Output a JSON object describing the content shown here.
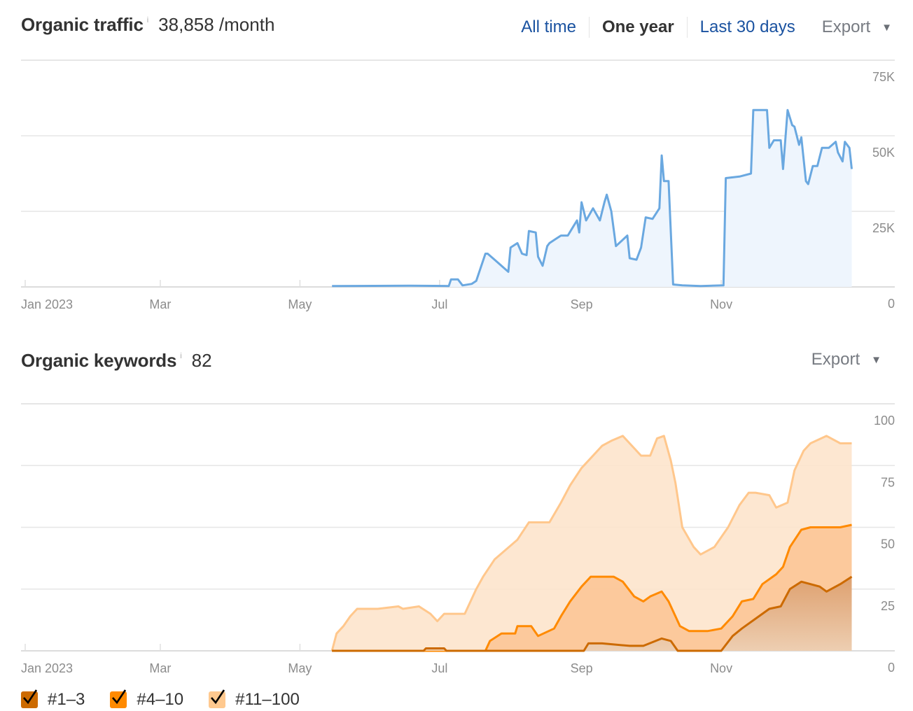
{
  "traffic": {
    "title": "Organic traffic",
    "info_icon": "i",
    "value": "38,858 /month",
    "ranges": [
      "All time",
      "One year",
      "Last 30 days"
    ],
    "active_range": "One year",
    "export_label": "Export"
  },
  "keywords": {
    "title": "Organic keywords",
    "info_icon": "i",
    "value": "82",
    "export_label": "Export",
    "legend": [
      {
        "label": "#1–3",
        "color": "#cc6a00",
        "checked": true
      },
      {
        "label": "#4–10",
        "color": "#ff8a00",
        "checked": true
      },
      {
        "label": "#11–100",
        "color": "#ffc98f",
        "checked": true
      }
    ]
  },
  "colors": {
    "traffic_line": "#6aa8e0",
    "traffic_fill": "#eef5fd",
    "kw_top3_line": "#cc6a00",
    "kw_top10_line": "#ff8a00",
    "kw_top100_line": "#ffc78c",
    "grid": "#e6e6e6",
    "link": "#1a52a0"
  },
  "chart_data": [
    {
      "type": "area",
      "title": "Organic traffic",
      "x_unit": "day of year 2023",
      "xlim": [
        0,
        365
      ],
      "x_ticks": [
        {
          "day": 0,
          "label": "Jan 2023"
        },
        {
          "day": 59,
          "label": "Mar"
        },
        {
          "day": 120,
          "label": "May"
        },
        {
          "day": 181,
          "label": "Jul"
        },
        {
          "day": 243,
          "label": "Sep"
        },
        {
          "day": 304,
          "label": "Nov"
        }
      ],
      "y_ticks": [
        {
          "value": 0,
          "label": "0"
        },
        {
          "value": 25000,
          "label": "25K"
        },
        {
          "value": 50000,
          "label": "50K"
        },
        {
          "value": 75000,
          "label": "75K"
        }
      ],
      "ylim": [
        0,
        75000
      ],
      "grid": true,
      "series": [
        {
          "name": "Organic traffic",
          "points": [
            [
              134,
              300
            ],
            [
              168,
              400
            ],
            [
              185,
              300
            ],
            [
              186,
              2500
            ],
            [
              189,
              2500
            ],
            [
              191,
              500
            ],
            [
              195,
              1000
            ],
            [
              197,
              2000
            ],
            [
              201,
              11000
            ],
            [
              202,
              11000
            ],
            [
              205,
              9000
            ],
            [
              208,
              7000
            ],
            [
              211,
              5000
            ],
            [
              212,
              13000
            ],
            [
              215,
              14500
            ],
            [
              217,
              11000
            ],
            [
              219,
              10500
            ],
            [
              220,
              18500
            ],
            [
              223,
              18000
            ],
            [
              224,
              10000
            ],
            [
              226,
              7000
            ],
            [
              228,
              13500
            ],
            [
              229,
              14500
            ],
            [
              232,
              16000
            ],
            [
              234,
              17000
            ],
            [
              237,
              17000
            ],
            [
              239,
              19500
            ],
            [
              241,
              22000
            ],
            [
              242,
              18000
            ],
            [
              243,
              28000
            ],
            [
              245,
              22000
            ],
            [
              248,
              26000
            ],
            [
              251,
              22000
            ],
            [
              253,
              28000
            ],
            [
              254,
              30500
            ],
            [
              256,
              25000
            ],
            [
              258,
              13500
            ],
            [
              263,
              17000
            ],
            [
              264,
              9500
            ],
            [
              267,
              9000
            ],
            [
              269,
              13000
            ],
            [
              271,
              23000
            ],
            [
              274,
              22500
            ],
            [
              277,
              26000
            ],
            [
              278,
              43500
            ],
            [
              279,
              35000
            ],
            [
              281,
              35000
            ],
            [
              283,
              800
            ],
            [
              287,
              500
            ],
            [
              295,
              300
            ],
            [
              305,
              500
            ],
            [
              306,
              36000
            ],
            [
              312,
              36500
            ],
            [
              317,
              37500
            ],
            [
              318,
              58500
            ],
            [
              324,
              58500
            ],
            [
              325,
              46000
            ],
            [
              327,
              48500
            ],
            [
              330,
              48500
            ],
            [
              331,
              39000
            ],
            [
              333,
              58500
            ],
            [
              335,
              53500
            ],
            [
              336,
              53000
            ],
            [
              338,
              47000
            ],
            [
              339,
              49500
            ],
            [
              341,
              35000
            ],
            [
              342,
              34000
            ],
            [
              344,
              40000
            ],
            [
              346,
              40000
            ],
            [
              348,
              46000
            ],
            [
              351,
              46000
            ],
            [
              354,
              48000
            ],
            [
              355,
              44500
            ],
            [
              357,
              41500
            ],
            [
              358,
              48000
            ],
            [
              360,
              46000
            ],
            [
              361,
              39000
            ]
          ]
        }
      ]
    },
    {
      "type": "area",
      "title": "Organic keywords",
      "x_unit": "day of year 2023",
      "xlim": [
        0,
        365
      ],
      "x_ticks": [
        {
          "day": 0,
          "label": "Jan 2023"
        },
        {
          "day": 59,
          "label": "Mar"
        },
        {
          "day": 120,
          "label": "May"
        },
        {
          "day": 181,
          "label": "Jul"
        },
        {
          "day": 243,
          "label": "Sep"
        },
        {
          "day": 304,
          "label": "Nov"
        }
      ],
      "y_ticks": [
        {
          "value": 0,
          "label": "0"
        },
        {
          "value": 25,
          "label": "25"
        },
        {
          "value": 50,
          "label": "50"
        },
        {
          "value": 75,
          "label": "75"
        },
        {
          "value": 100,
          "label": "100"
        }
      ],
      "ylim": [
        0,
        100
      ],
      "grid": true,
      "legend_position": "bottom-left",
      "series": [
        {
          "name": "#11–100",
          "points": [
            [
              134,
              0
            ],
            [
              136,
              7
            ],
            [
              139,
              10
            ],
            [
              142,
              14
            ],
            [
              145,
              17
            ],
            [
              154,
              17
            ],
            [
              163,
              18
            ],
            [
              165,
              17
            ],
            [
              172,
              18
            ],
            [
              177,
              15
            ],
            [
              180,
              12
            ],
            [
              183,
              15
            ],
            [
              192,
              15
            ],
            [
              197,
              25
            ],
            [
              200,
              30
            ],
            [
              205,
              37
            ],
            [
              215,
              45
            ],
            [
              220,
              52
            ],
            [
              229,
              52
            ],
            [
              234,
              60
            ],
            [
              238,
              67
            ],
            [
              243,
              74
            ],
            [
              247,
              78
            ],
            [
              252,
              83
            ],
            [
              256,
              85
            ],
            [
              261,
              87
            ],
            [
              264,
              84
            ],
            [
              269,
              79
            ],
            [
              273,
              79
            ],
            [
              276,
              86
            ],
            [
              279,
              87
            ],
            [
              282,
              77
            ],
            [
              284,
              68
            ],
            [
              287,
              50
            ],
            [
              292,
              42
            ],
            [
              295,
              39
            ],
            [
              301,
              42
            ],
            [
              307,
              50
            ],
            [
              312,
              59
            ],
            [
              316,
              64
            ],
            [
              319,
              64
            ],
            [
              325,
              63
            ],
            [
              328,
              58
            ],
            [
              333,
              60
            ],
            [
              336,
              73
            ],
            [
              340,
              81
            ],
            [
              343,
              84
            ],
            [
              350,
              87
            ],
            [
              356,
              84
            ],
            [
              361,
              84
            ]
          ]
        },
        {
          "name": "#4–10",
          "points": [
            [
              134,
              0
            ],
            [
              201,
              0
            ],
            [
              203,
              4
            ],
            [
              208,
              7
            ],
            [
              214,
              7
            ],
            [
              215,
              10
            ],
            [
              221,
              10
            ],
            [
              224,
              6
            ],
            [
              231,
              9
            ],
            [
              234,
              14
            ],
            [
              238,
              20
            ],
            [
              243,
              26
            ],
            [
              247,
              30
            ],
            [
              252,
              30
            ],
            [
              257,
              30
            ],
            [
              261,
              28
            ],
            [
              266,
              22
            ],
            [
              270,
              20
            ],
            [
              273,
              22
            ],
            [
              278,
              24
            ],
            [
              281,
              20
            ],
            [
              286,
              10
            ],
            [
              290,
              8
            ],
            [
              298,
              8
            ],
            [
              304,
              9
            ],
            [
              309,
              14
            ],
            [
              313,
              20
            ],
            [
              318,
              21
            ],
            [
              322,
              27
            ],
            [
              328,
              31
            ],
            [
              331,
              34
            ],
            [
              334,
              42
            ],
            [
              339,
              49
            ],
            [
              343,
              50
            ],
            [
              350,
              50
            ],
            [
              356,
              50
            ],
            [
              361,
              51
            ]
          ]
        },
        {
          "name": "#1–3",
          "points": [
            [
              134,
              0
            ],
            [
              174,
              0
            ],
            [
              175,
              1
            ],
            [
              183,
              1
            ],
            [
              184,
              0
            ],
            [
              244,
              0
            ],
            [
              246,
              3
            ],
            [
              252,
              3
            ],
            [
              264,
              2
            ],
            [
              270,
              2
            ],
            [
              278,
              5
            ],
            [
              282,
              4
            ],
            [
              285,
              0
            ],
            [
              304,
              0
            ],
            [
              309,
              6
            ],
            [
              313,
              9
            ],
            [
              319,
              13
            ],
            [
              325,
              17
            ],
            [
              330,
              18
            ],
            [
              334,
              25
            ],
            [
              339,
              28
            ],
            [
              347,
              26
            ],
            [
              350,
              24
            ],
            [
              356,
              27
            ],
            [
              361,
              30
            ]
          ]
        }
      ]
    }
  ]
}
